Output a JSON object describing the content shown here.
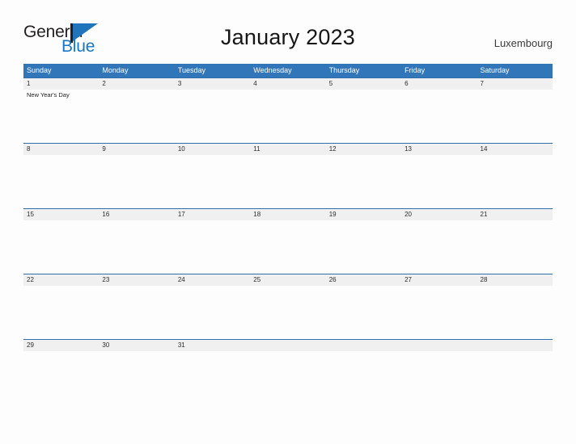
{
  "brand": {
    "name_top": "General",
    "name_bottom": "Blue",
    "mark_icon": "flag-triangle-icon",
    "color_blue": "#1877c4",
    "color_dark": "#231f20"
  },
  "header": {
    "title": "January 2023",
    "region": "Luxembourg"
  },
  "calendar": {
    "header_color": "#3076b9",
    "band_color": "#f0f0f0",
    "weekdays": [
      "Sunday",
      "Monday",
      "Tuesday",
      "Wednesday",
      "Thursday",
      "Friday",
      "Saturday"
    ],
    "weeks": [
      {
        "days": [
          {
            "num": "1",
            "event": "New Year's Day"
          },
          {
            "num": "2",
            "event": ""
          },
          {
            "num": "3",
            "event": ""
          },
          {
            "num": "4",
            "event": ""
          },
          {
            "num": "5",
            "event": ""
          },
          {
            "num": "6",
            "event": ""
          },
          {
            "num": "7",
            "event": ""
          }
        ]
      },
      {
        "days": [
          {
            "num": "8",
            "event": ""
          },
          {
            "num": "9",
            "event": ""
          },
          {
            "num": "10",
            "event": ""
          },
          {
            "num": "11",
            "event": ""
          },
          {
            "num": "12",
            "event": ""
          },
          {
            "num": "13",
            "event": ""
          },
          {
            "num": "14",
            "event": ""
          }
        ]
      },
      {
        "days": [
          {
            "num": "15",
            "event": ""
          },
          {
            "num": "16",
            "event": ""
          },
          {
            "num": "17",
            "event": ""
          },
          {
            "num": "18",
            "event": ""
          },
          {
            "num": "19",
            "event": ""
          },
          {
            "num": "20",
            "event": ""
          },
          {
            "num": "21",
            "event": ""
          }
        ]
      },
      {
        "days": [
          {
            "num": "22",
            "event": ""
          },
          {
            "num": "23",
            "event": ""
          },
          {
            "num": "24",
            "event": ""
          },
          {
            "num": "25",
            "event": ""
          },
          {
            "num": "26",
            "event": ""
          },
          {
            "num": "27",
            "event": ""
          },
          {
            "num": "28",
            "event": ""
          }
        ]
      },
      {
        "days": [
          {
            "num": "29",
            "event": ""
          },
          {
            "num": "30",
            "event": ""
          },
          {
            "num": "31",
            "event": ""
          },
          {
            "num": "",
            "event": ""
          },
          {
            "num": "",
            "event": ""
          },
          {
            "num": "",
            "event": ""
          },
          {
            "num": "",
            "event": ""
          }
        ]
      }
    ]
  }
}
